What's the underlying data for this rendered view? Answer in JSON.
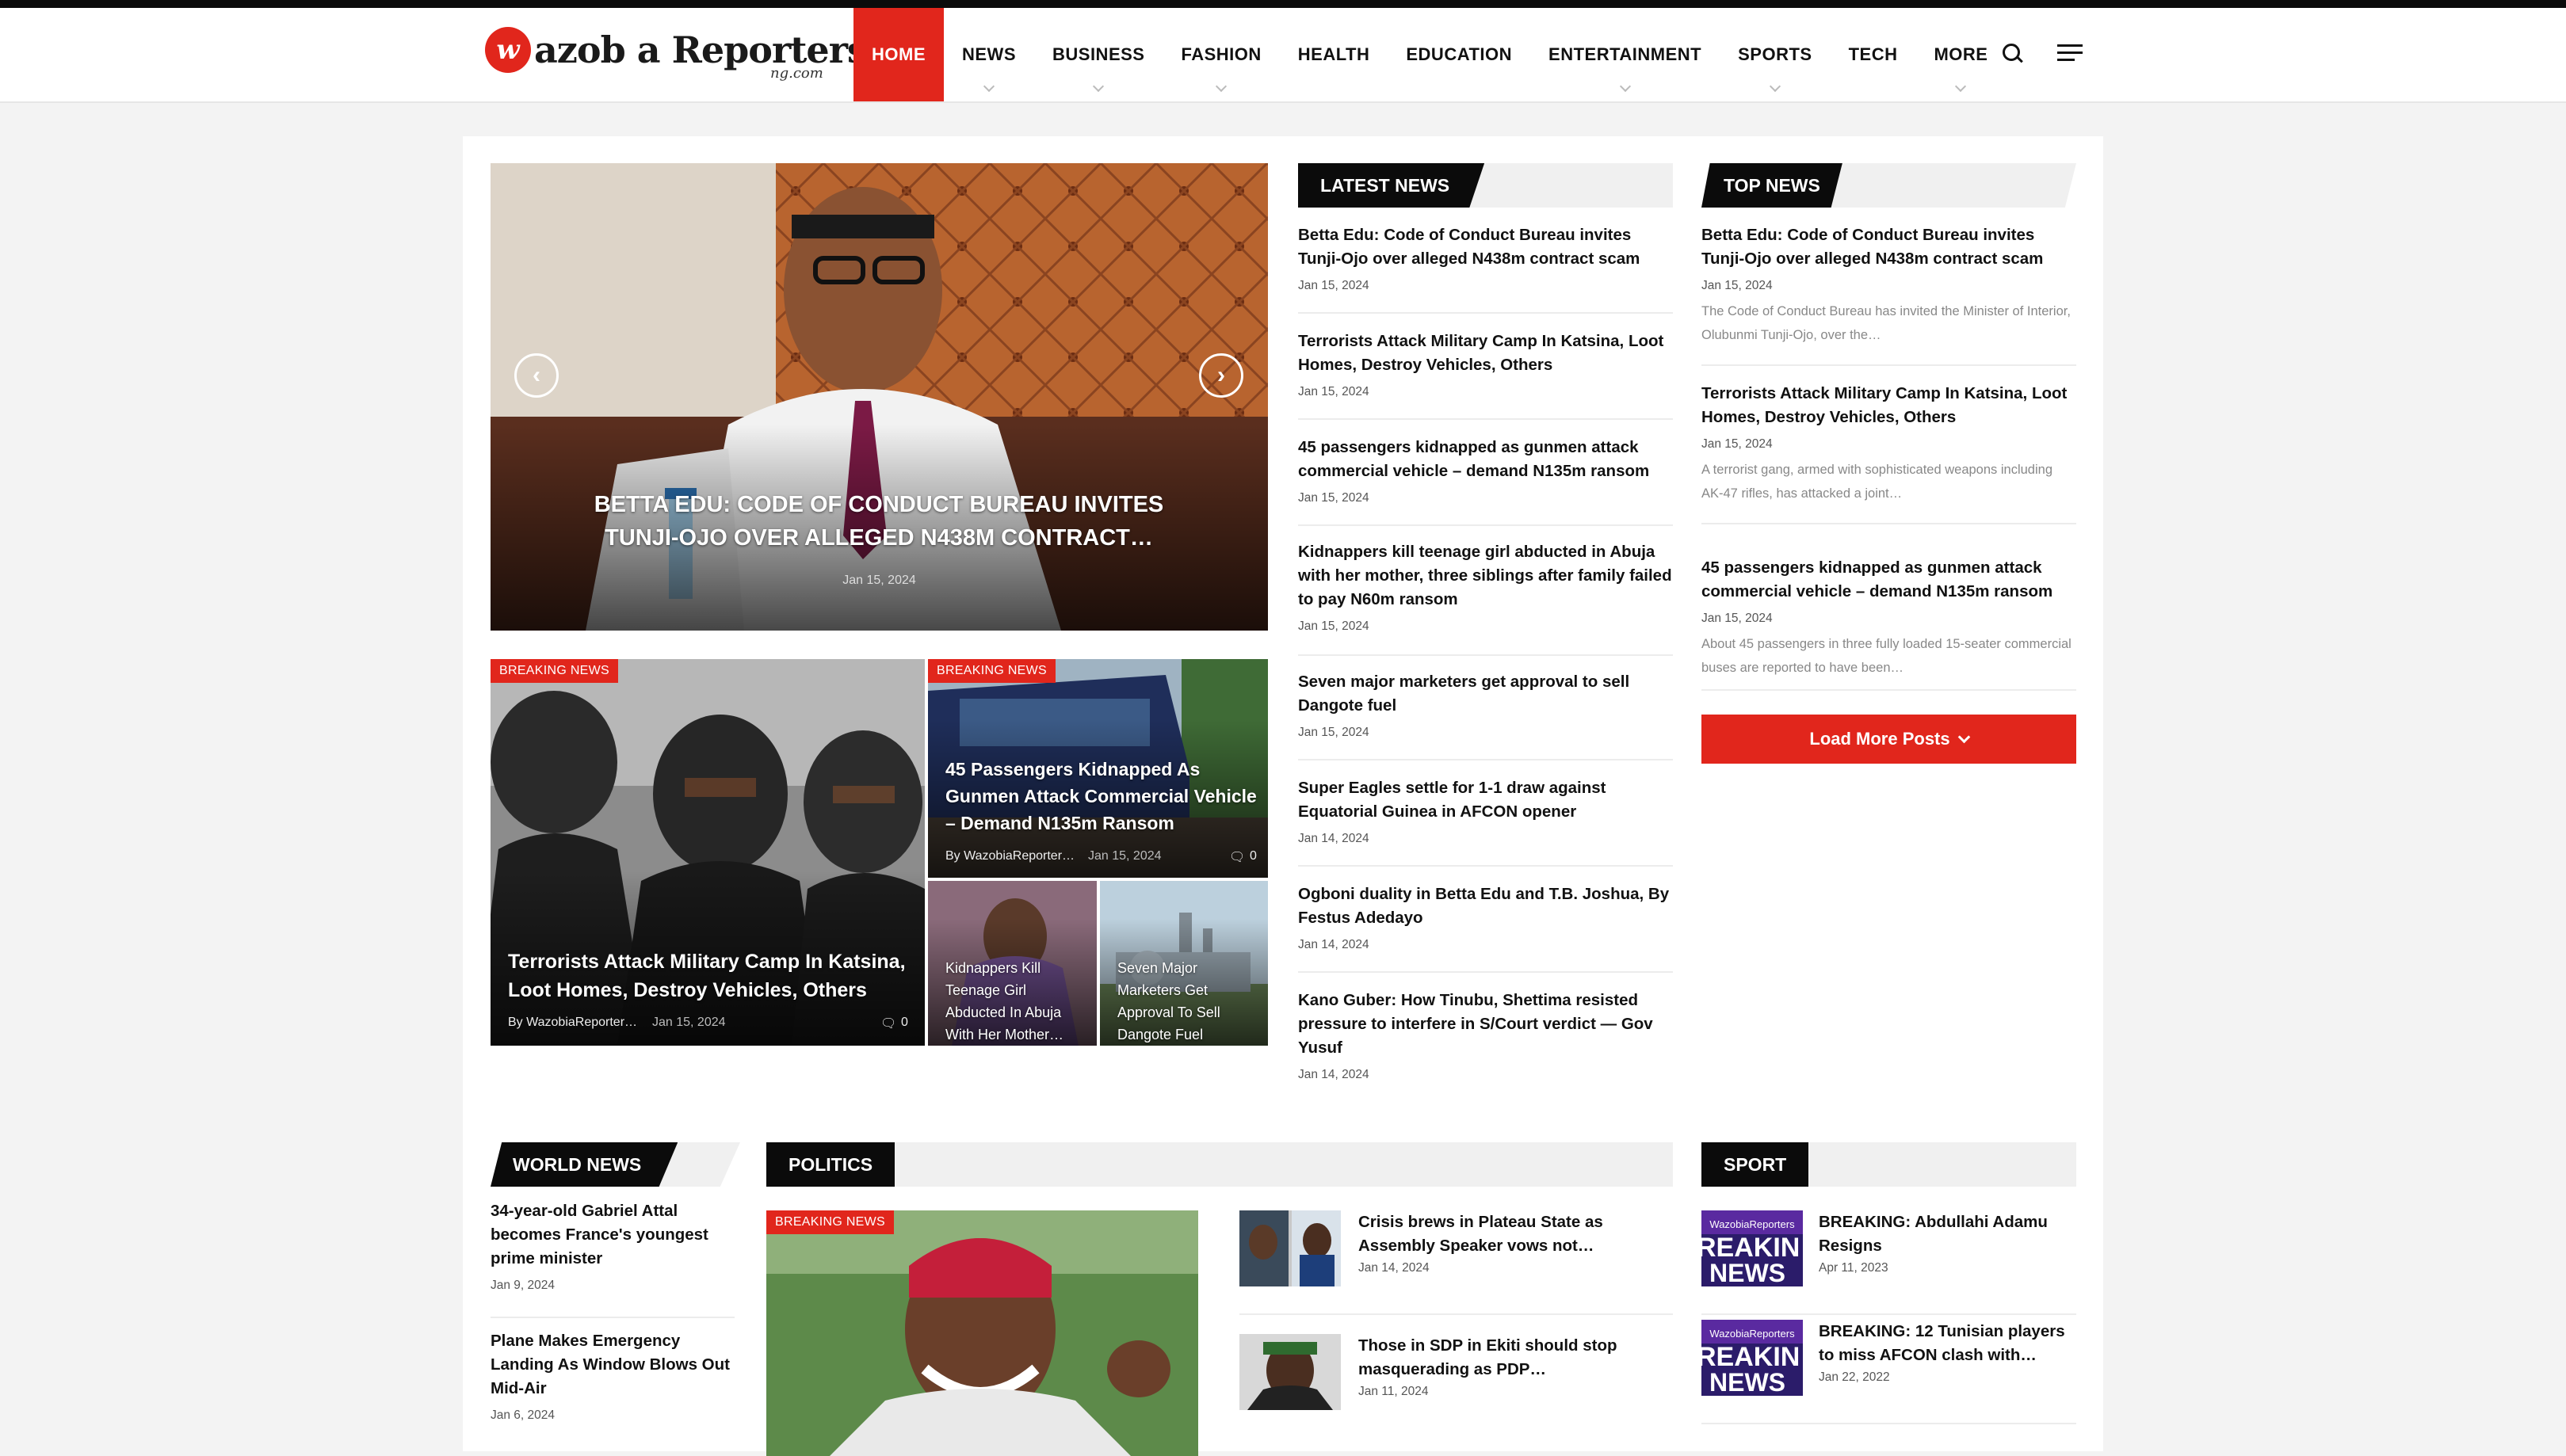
{
  "header": {
    "logo_main": "azob a Reporters",
    "logo_w": "w",
    "logo_sub": "ng.com",
    "nav": [
      {
        "label": "HOME",
        "active": true,
        "dropdown": false
      },
      {
        "label": "NEWS",
        "active": false,
        "dropdown": true
      },
      {
        "label": "BUSINESS",
        "active": false,
        "dropdown": true
      },
      {
        "label": "FASHION",
        "active": false,
        "dropdown": true
      },
      {
        "label": "HEALTH",
        "active": false,
        "dropdown": false
      },
      {
        "label": "EDUCATION",
        "active": false,
        "dropdown": false
      },
      {
        "label": "ENTERTAINMENT",
        "active": false,
        "dropdown": true
      },
      {
        "label": "SPORTS",
        "active": false,
        "dropdown": true
      },
      {
        "label": "TECH",
        "active": false,
        "dropdown": false
      },
      {
        "label": "MORE",
        "active": false,
        "dropdown": true
      }
    ],
    "search_icon": "search-icon",
    "menu_icon": "hamburger-menu-icon"
  },
  "slider": {
    "title": "BETTA EDU: CODE OF CONDUCT BUREAU INVITES TUNJI-OJO OVER ALLEGED N438M CONTRACT…",
    "date": "Jan 15, 2024",
    "prev_icon": "chevron-left-icon",
    "next_icon": "chevron-right-icon"
  },
  "grid": {
    "big": {
      "badge": "BREAKING NEWS",
      "title": "Terrorists Attack Military Camp In Katsina, Loot Homes, Destroy Vehicles, Others",
      "author": "By WazobiaReporter…",
      "date": "Jan 15, 2024",
      "comments": "0"
    },
    "top_right": {
      "badge": "BREAKING NEWS",
      "title": "45 Passengers Kidnapped As Gunmen Attack Commercial Vehicle – Demand N135m Ransom",
      "author": "By WazobiaReporter…",
      "date": "Jan 15, 2024",
      "comments": "0"
    },
    "small1": {
      "title": "Kidnappers Kill Teenage Girl Abducted In Abuja With Her Mother…"
    },
    "small2": {
      "title": "Seven Major Marketers Get Approval To Sell Dangote Fuel"
    }
  },
  "latest_news": {
    "heading": "LATEST NEWS",
    "items": [
      {
        "title": "Betta Edu: Code of Conduct Bureau invites Tunji-Ojo over alleged N438m contract scam",
        "date": "Jan 15, 2024"
      },
      {
        "title": "Terrorists Attack Military Camp In Katsina, Loot Homes, Destroy Vehicles, Others",
        "date": "Jan 15, 2024"
      },
      {
        "title": "45 passengers kidnapped as gunmen attack commercial vehicle – demand N135m ransom",
        "date": "Jan 15, 2024"
      },
      {
        "title": "Kidnappers kill teenage girl abducted in Abuja with her mother, three siblings after family failed to pay N60m ransom",
        "date": "Jan 15, 2024"
      },
      {
        "title": "Seven major marketers get approval to sell Dangote fuel",
        "date": "Jan 15, 2024"
      },
      {
        "title": "Super Eagles settle for 1-1 draw against Equatorial Guinea in AFCON opener",
        "date": "Jan 14, 2024"
      },
      {
        "title": "Ogboni duality in Betta Edu and T.B. Joshua, By Festus Adedayo",
        "date": "Jan 14, 2024"
      },
      {
        "title": "Kano Guber: How Tinubu, Shettima resisted pressure to interfere in S/Court verdict — Gov Yusuf",
        "date": "Jan 14, 2024"
      }
    ]
  },
  "top_news": {
    "heading": "TOP NEWS",
    "items": [
      {
        "title": "Betta Edu: Code of Conduct Bureau invites Tunji-Ojo over alleged N438m contract scam",
        "date": "Jan 15, 2024",
        "excerpt": "The Code of Conduct Bureau has invited the Minister of Interior, Olubunmi Tunji-Ojo, over the…"
      },
      {
        "title": "Terrorists Attack Military Camp In Katsina, Loot Homes, Destroy Vehicles, Others",
        "date": "Jan 15, 2024",
        "excerpt": "A terrorist gang, armed with sophisticated weapons including AK-47 rifles, has attacked a joint…"
      },
      {
        "title": "45 passengers kidnapped as gunmen attack commercial vehicle – demand N135m ransom",
        "date": "Jan 15, 2024",
        "excerpt": "About 45 passengers in three fully loaded 15-seater commercial buses are reported to have been…"
      }
    ],
    "load_more": "Load More Posts"
  },
  "world_news": {
    "heading": "WORLD NEWS",
    "items": [
      {
        "title": "34-year-old Gabriel Attal becomes France's youngest prime minister",
        "date": "Jan 9, 2024"
      },
      {
        "title": "Plane Makes Emergency Landing As Window Blows Out Mid-Air",
        "date": "Jan 6, 2024"
      }
    ]
  },
  "politics": {
    "heading": "POLITICS",
    "feature_badge": "BREAKING NEWS",
    "items": [
      {
        "title": "Crisis brews in Plateau State as Assembly Speaker vows not…",
        "date": "Jan 14, 2024"
      },
      {
        "title": "Those in SDP in Ekiti should stop masquerading as PDP…",
        "date": "Jan 11, 2024"
      }
    ]
  },
  "sport": {
    "heading": "SPORT",
    "thumb_brand": "WazobiaReporters",
    "thumb_word": "REAKIN NEWS",
    "items": [
      {
        "title": "BREAKING: Abdullahi Adamu Resigns",
        "date": "Apr 11, 2023"
      },
      {
        "title": "BREAKING: 12 Tunisian players to miss AFCON clash with…",
        "date": "Jan 22, 2022"
      }
    ]
  }
}
